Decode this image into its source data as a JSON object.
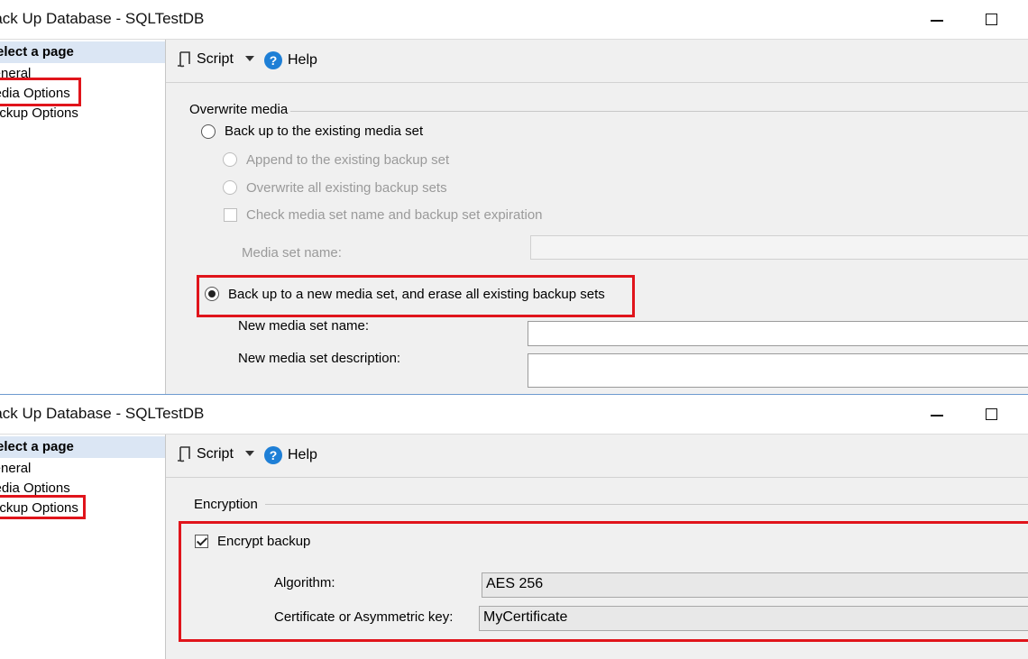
{
  "window1": {
    "title": "Back Up Database - SQLTestDB",
    "sidebar": {
      "header": "Select a page",
      "items": [
        "General",
        "Media Options",
        "Backup Options"
      ]
    },
    "toolbar": {
      "script_label": "Script",
      "help_label": "Help"
    },
    "overwrite_media": {
      "section_label": "Overwrite media",
      "existing_media_set": "Back up to the existing media set",
      "append": "Append to the existing backup set",
      "overwrite_all": "Overwrite all existing backup sets",
      "check_media": "Check media set name and backup set expiration",
      "media_set_name_label": "Media set name:",
      "new_media_set": "Back up to a new media set, and erase all existing backup sets",
      "new_media_set_name_label": "New media set name:",
      "new_media_set_description_label": "New media set description:",
      "new_media_set_name_value": "",
      "new_media_set_description_value": ""
    }
  },
  "window2": {
    "title": "Back Up Database - SQLTestDB",
    "sidebar": {
      "header": "Select a page",
      "items": [
        "General",
        "Media Options",
        "Backup Options"
      ]
    },
    "toolbar": {
      "script_label": "Script",
      "help_label": "Help"
    },
    "encryption": {
      "section_label": "Encryption",
      "encrypt_backup_label": "Encrypt backup",
      "algorithm_label": "Algorithm:",
      "algorithm_value": "AES 256",
      "certificate_label": "Certificate or Asymmetric key:",
      "certificate_value": "MyCertificate"
    }
  },
  "colors": {
    "highlight": "#e0141b",
    "sidebar_header": "#dbe6f4",
    "panel": "#f0f0f0",
    "help_icon": "#1e7fd6"
  }
}
